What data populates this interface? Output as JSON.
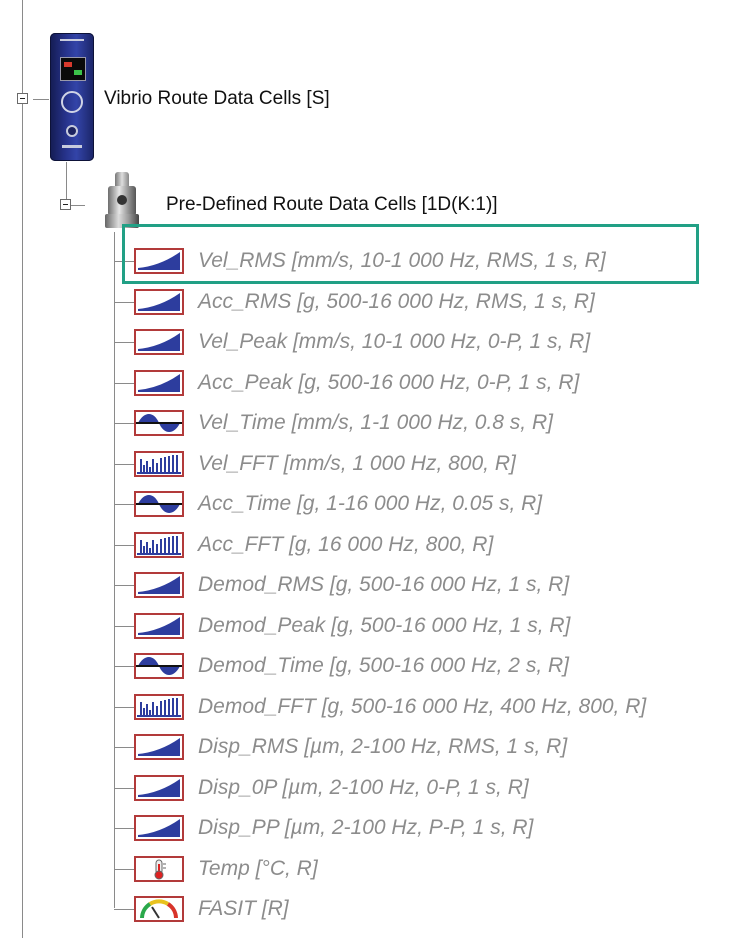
{
  "tree": {
    "root": {
      "label": "Vibrio Route Data Cells [S]",
      "icon": "vibrio-device-icon"
    },
    "child": {
      "label": "Pre-Defined Route Data Cells [1D(K:1)]",
      "icon": "sensor-icon"
    },
    "items": [
      {
        "label": "Vel_RMS [mm/s, 10-1 000 Hz, RMS, 1 s, R]",
        "icon": "ramp-icon"
      },
      {
        "label": "Acc_RMS [g, 500-16 000 Hz, RMS, 1 s, R]",
        "icon": "ramp-icon"
      },
      {
        "label": "Vel_Peak [mm/s, 10-1 000 Hz, 0-P, 1 s, R]",
        "icon": "ramp-icon"
      },
      {
        "label": "Acc_Peak [g, 500-16 000 Hz, 0-P, 1 s, R]",
        "icon": "ramp-icon"
      },
      {
        "label": "Vel_Time [mm/s, 1-1 000 Hz, 0.8 s, R]",
        "icon": "sine-wave-icon"
      },
      {
        "label": "Vel_FFT [mm/s, 1 000 Hz, 800, R]",
        "icon": "spectrum-icon"
      },
      {
        "label": "Acc_Time [g, 1-16 000 Hz, 0.05 s, R]",
        "icon": "sine-wave-icon"
      },
      {
        "label": "Acc_FFT [g, 16 000 Hz, 800, R]",
        "icon": "spectrum-icon"
      },
      {
        "label": "Demod_RMS [g, 500-16 000 Hz, 1 s, R]",
        "icon": "ramp-icon"
      },
      {
        "label": "Demod_Peak [g, 500-16 000 Hz, 1 s, R]",
        "icon": "ramp-icon"
      },
      {
        "label": "Demod_Time [g, 500-16 000 Hz, 2 s, R]",
        "icon": "sine-wave-icon"
      },
      {
        "label": "Demod_FFT [g, 500-16 000 Hz, 400 Hz, 800, R]",
        "icon": "spectrum-icon"
      },
      {
        "label": "Disp_RMS [µm, 2-100 Hz, RMS, 1 s, R]",
        "icon": "ramp-icon"
      },
      {
        "label": "Disp_0P [µm, 2-100 Hz, 0-P, 1 s, R]",
        "icon": "ramp-icon"
      },
      {
        "label": "Disp_PP [µm, 2-100 Hz, P-P, 1 s, R]",
        "icon": "ramp-icon"
      },
      {
        "label": "Temp [°C, R]",
        "icon": "thermometer-icon"
      },
      {
        "label": "FASIT [R]",
        "icon": "gauge-icon"
      }
    ]
  },
  "colors": {
    "icon_border": "#b23a3a",
    "icon_fill": "#2d3d9e",
    "item_text": "#8c8c8c",
    "highlight": "#21a085"
  },
  "selected_item_index": 0
}
